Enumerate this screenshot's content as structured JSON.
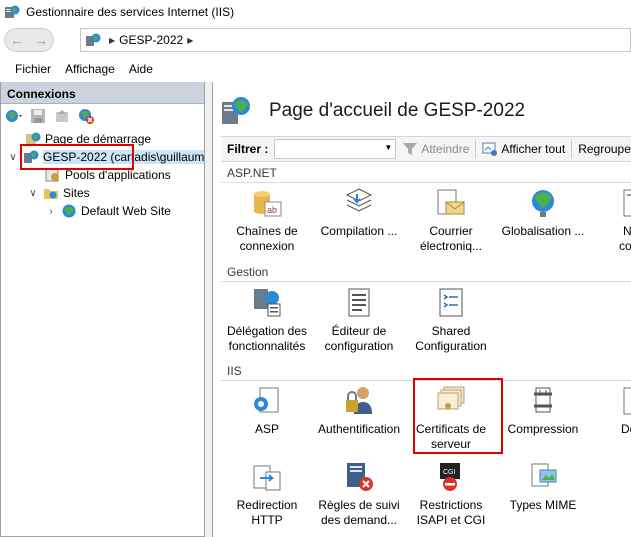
{
  "window": {
    "title": "Gestionnaire des services Internet (IIS)"
  },
  "address": {
    "crumbs": [
      "GESP-2022"
    ]
  },
  "menu": {
    "items": [
      "Fichier",
      "Affichage",
      "Aide"
    ]
  },
  "connections": {
    "header": "Connexions",
    "tree": {
      "start_page": "Page de démarrage",
      "server": "GESP-2022 (cartadis\\guillaum",
      "app_pools": "Pools d'applications",
      "sites": "Sites",
      "default_site": "Default Web Site"
    }
  },
  "home": {
    "title": "Page d'accueil de GESP-2022",
    "filter": {
      "label": "Filtrer :",
      "value": "",
      "go": "Atteindre",
      "show_all": "Afficher tout",
      "group_by": "Regroupe"
    },
    "groups": {
      "aspnet": {
        "name": "ASP.NET",
        "features": [
          "Chaînes de\nconnexion",
          "Compilation ...",
          "Courrier\nélectroniq...",
          "Globalisation ...",
          "Nive\nconfia"
        ]
      },
      "management": {
        "name": "Gestion",
        "features": [
          "Délégation des\nfonctionnalités",
          "Éditeur de\nconfiguration",
          "Shared\nConfiguration"
        ]
      },
      "iis": {
        "name": "IIS",
        "features": [
          "ASP",
          "Authentification",
          "Certificats de\nserveur",
          "Compression",
          "Docu\nd",
          "Redirection\nHTTP",
          "Règles de suivi\ndes demand...",
          "Restrictions\nISAPI et CGI",
          "Types MIME"
        ]
      }
    }
  },
  "colors": {
    "accent_highlight": "#e00000",
    "header_bg": "#cdd3de"
  }
}
